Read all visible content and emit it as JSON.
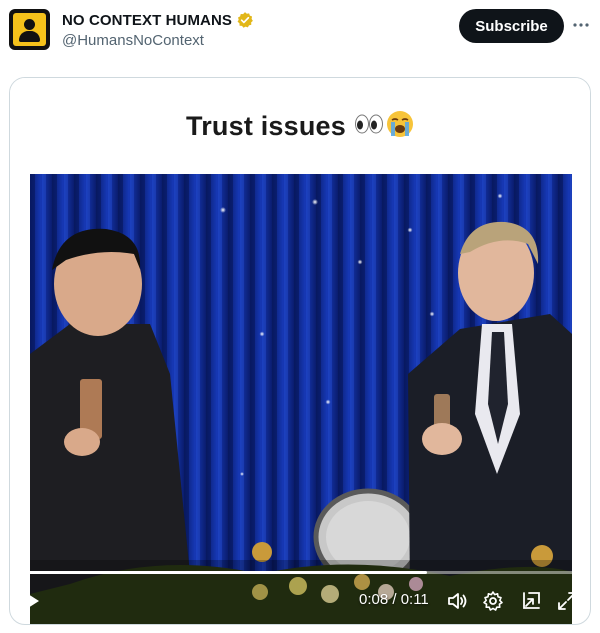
{
  "post": {
    "display_name": "NO CONTEXT HUMANS",
    "handle": "@HumansNoContext",
    "subscribe_label": "Subscribe",
    "verified_icon": "verified-badge-icon",
    "more_icon": "more-options-icon"
  },
  "media": {
    "caption": "Trust issues",
    "caption_emojis": [
      "eyes-emoji",
      "crying-face-emoji"
    ],
    "video": {
      "current_time": "0:08",
      "total_time": "0:11",
      "time_display": "0:08 / 0:11",
      "progress_fraction": 0.727
    },
    "controls": {
      "play_icon": "play-icon",
      "volume_icon": "volume-icon",
      "settings_icon": "settings-gear-icon",
      "pip_icon": "picture-in-picture-icon",
      "fullscreen_icon": "fullscreen-icon"
    }
  },
  "colors": {
    "accent_dark": "#0f1419",
    "secondary_text": "#536471",
    "verified_gold": "#e2b719",
    "avatar_yellow": "#f5c21b",
    "video_backdrop_blue": "#0a1f7a"
  }
}
